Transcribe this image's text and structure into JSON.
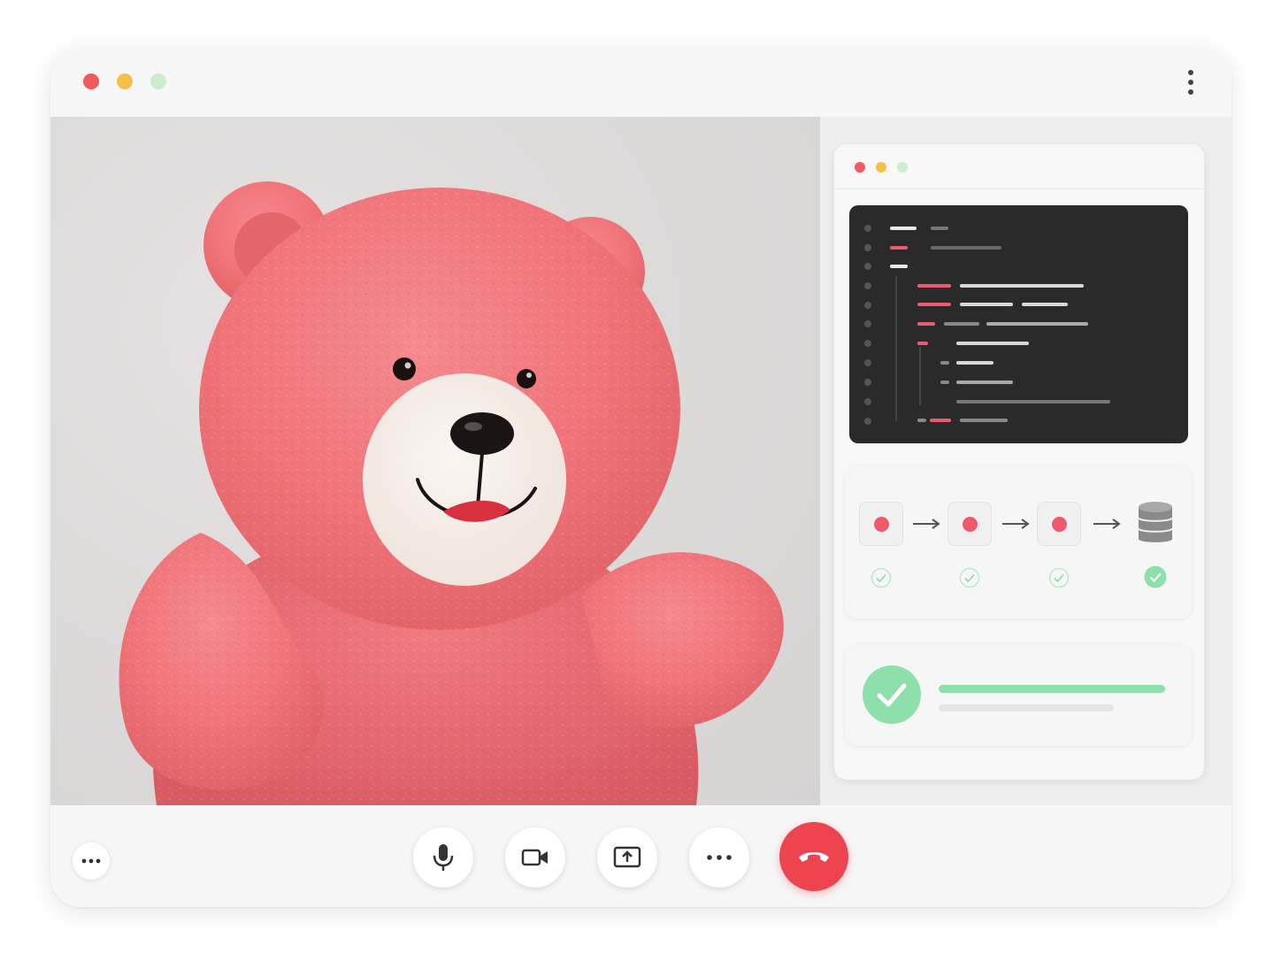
{
  "colors": {
    "close": "#f15a5f",
    "minimize": "#f5c04a",
    "maximize": "#c9efcf",
    "end_call": "#ee4450",
    "accent_pink": "#ee5a6c",
    "success_green": "#7fdca0",
    "code_bg": "#2a2a2b"
  },
  "titlebar": {
    "controls": [
      "close-dot",
      "minimize-dot",
      "maximize-dot"
    ],
    "menu_icon": "vertical-ellipsis-icon"
  },
  "video": {
    "participant_image": "pink-teddy-bear-waving"
  },
  "screen_share": {
    "window_controls": [
      "close-dot",
      "minimize-dot",
      "maximize-dot"
    ],
    "code_panel": "code-editor-illustration",
    "pipeline": {
      "steps": [
        {
          "icon": "pink-dot-icon",
          "status": "done"
        },
        {
          "icon": "pink-dot-icon",
          "status": "done"
        },
        {
          "icon": "pink-dot-icon",
          "status": "done"
        },
        {
          "icon": "database-icon",
          "status": "complete"
        }
      ]
    },
    "success_card": {
      "icon": "check-circle-icon",
      "progress": 1.0
    }
  },
  "controls": {
    "left": "more-options-icon",
    "buttons": [
      {
        "name": "microphone",
        "icon": "microphone-icon"
      },
      {
        "name": "camera",
        "icon": "video-camera-icon"
      },
      {
        "name": "share-screen",
        "icon": "screen-share-icon"
      },
      {
        "name": "more",
        "icon": "more-horizontal-icon"
      },
      {
        "name": "end-call",
        "icon": "hang-up-icon"
      }
    ]
  }
}
